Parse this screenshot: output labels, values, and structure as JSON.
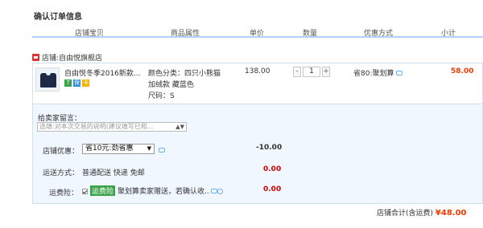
{
  "page_title": "确认订单信息",
  "columns": [
    "店铺宝贝",
    "商品属性",
    "单价",
    "数量",
    "优惠方式",
    "小计"
  ],
  "store": {
    "prefix": "店铺:",
    "name": "自由悦旗舰店"
  },
  "item": {
    "name": "自由悦冬季2016新款...",
    "attr_lines": [
      "颜色分类：四只小熊猫",
      "加绒款 藏蓝色",
      "尺码：S"
    ],
    "price": "138.00",
    "quantity": "1",
    "minus": "-",
    "plus": "+",
    "promotion": "省80:聚划算",
    "subtotal": "58.00",
    "badges": [
      "7",
      "保",
      "卡"
    ]
  },
  "message": {
    "label": "给卖家留言：",
    "placeholder": "选填:对本次交易的说明(建议填写已和..."
  },
  "shop_discount": {
    "label": "店铺优惠：",
    "selected": "省10元:劲省惠",
    "amount": "-10.00"
  },
  "shipping": {
    "label": "运送方式：",
    "value": "普通配送 快递 免邮",
    "amount": "0.00"
  },
  "insurance": {
    "label": "运费险：",
    "badge": "运费险",
    "text": "聚划算卖家赠送，若确认收..",
    "amount": "0.00"
  },
  "total": {
    "label": "店铺合计(含运费)",
    "amount": "¥48.00"
  },
  "colors": {
    "accent": "#f23a00",
    "header_border": "#b2d1ff",
    "panel_bg": "#f1f7ff"
  }
}
